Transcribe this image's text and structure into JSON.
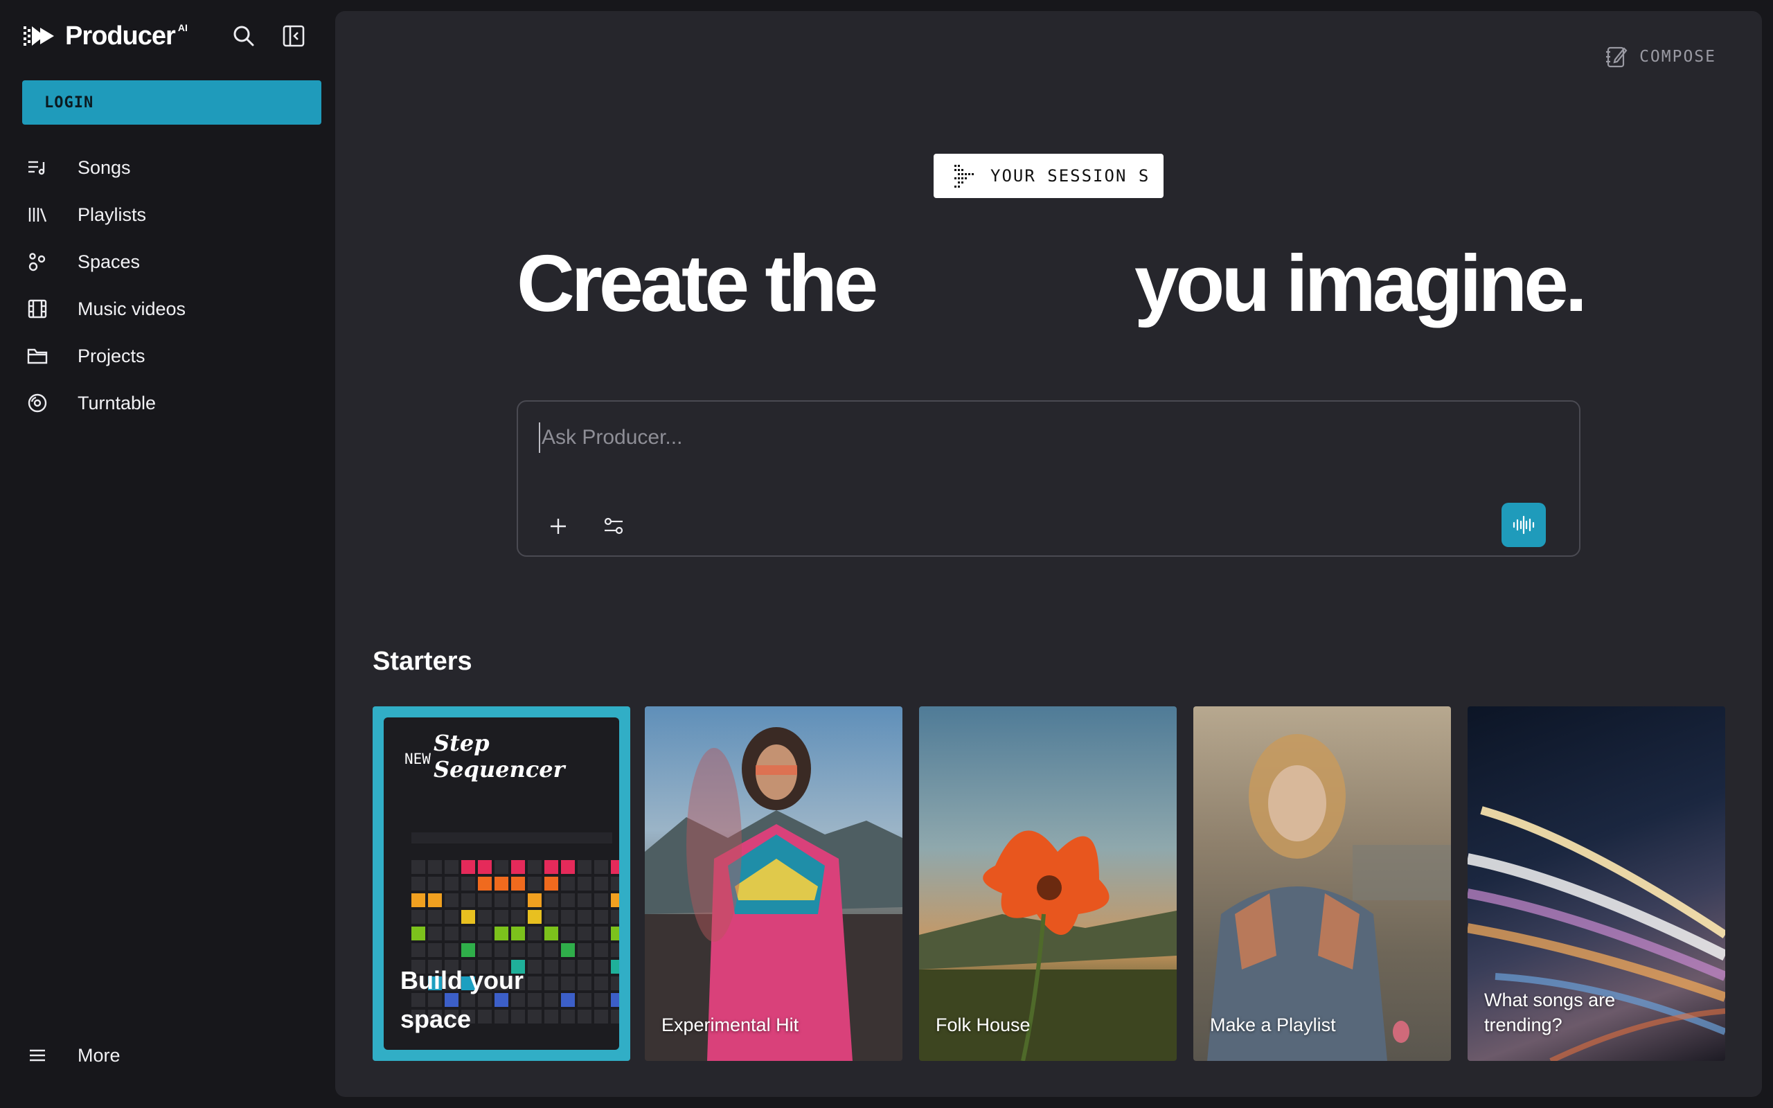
{
  "brand": {
    "name": "Producer",
    "superscript": "AI"
  },
  "sidebar": {
    "login_label": "LOGIN",
    "items": [
      {
        "label": "Songs",
        "icon": "songs-icon"
      },
      {
        "label": "Playlists",
        "icon": "library-icon"
      },
      {
        "label": "Spaces",
        "icon": "spaces-icon"
      },
      {
        "label": "Music videos",
        "icon": "film-icon"
      },
      {
        "label": "Projects",
        "icon": "folder-icon"
      },
      {
        "label": "Turntable",
        "icon": "disc-icon"
      }
    ],
    "more_label": "More"
  },
  "header": {
    "compose_label": "COMPOSE"
  },
  "hero": {
    "session_label": "YOUR SESSION S",
    "headline_left": "Create the",
    "headline_right": "you imagine."
  },
  "prompt": {
    "placeholder": "Ask Producer..."
  },
  "starters": {
    "title": "Starters",
    "cards": [
      {
        "label": "Build your space",
        "badge": "NEW",
        "title": "Step Sequencer"
      },
      {
        "label": "Experimental Hit"
      },
      {
        "label": "Folk House"
      },
      {
        "label": "Make a Playlist"
      },
      {
        "label": "What songs are trending?"
      }
    ]
  },
  "colors": {
    "accent": "#1f9bbb",
    "panel": "#26262c",
    "background": "#17171b"
  }
}
